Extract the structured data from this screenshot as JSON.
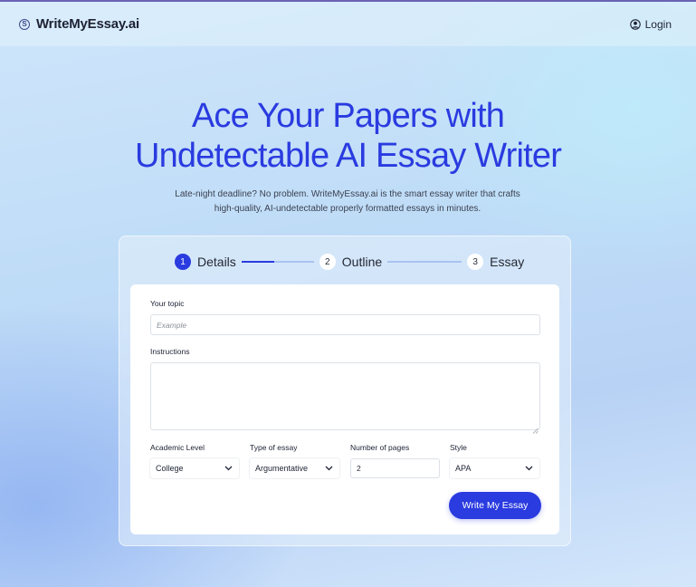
{
  "header": {
    "brand_name": "WriteMyEssay.ai",
    "logo_glyph": "S",
    "login_label": "Login"
  },
  "hero": {
    "title_line1": "Ace Your Papers with",
    "title_line2": "Undetectable AI Essay Writer",
    "subtitle_line1": "Late-night deadline? No problem. WriteMyEssay.ai is the smart essay writer that crafts",
    "subtitle_line2": "high-quality, AI-undetectable properly formatted essays in minutes."
  },
  "stepper": {
    "steps": [
      {
        "number": "1",
        "label": "Details",
        "active": true
      },
      {
        "number": "2",
        "label": "Outline",
        "active": false
      },
      {
        "number": "3",
        "label": "Essay",
        "active": false
      }
    ]
  },
  "form": {
    "topic": {
      "label": "Your topic",
      "placeholder": "Example",
      "value": ""
    },
    "instructions": {
      "label": "Instructions",
      "value": ""
    },
    "academic_level": {
      "label": "Academic Level",
      "selected": "College"
    },
    "essay_type": {
      "label": "Type of essay",
      "selected": "Argumentative"
    },
    "pages": {
      "label": "Number of pages",
      "value": "2"
    },
    "style": {
      "label": "Style",
      "selected": "APA"
    },
    "submit_label": "Write My Essay"
  },
  "colors": {
    "accent": "#2a3be0",
    "text": "#1d2233",
    "background": "#c4dcf7"
  }
}
